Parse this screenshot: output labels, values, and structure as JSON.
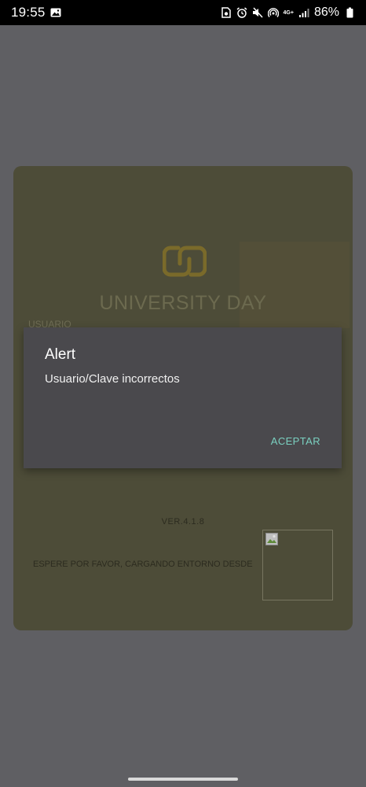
{
  "status_bar": {
    "time": "19:55",
    "network_label": "4G+",
    "battery": "86%",
    "left_icons": [
      "gallery-icon"
    ],
    "right_icons": [
      "sim-icon",
      "alarm-icon",
      "mute-icon",
      "hotspot-icon",
      "signal-icon",
      "battery-icon"
    ]
  },
  "login": {
    "brand": "UNIVERSITY DAY",
    "username_label": "USUARIO",
    "version": "VER.4.1.8",
    "loading_text": "ESPERE POR FAVOR, CARGANDO ENTORNO DESDE",
    "logo_color": "#7a6a2a"
  },
  "alert": {
    "title": "Alert",
    "message": "Usuario/Clave incorrectos",
    "button_label": "ACEPTAR",
    "button_color": "#7ad0c0"
  },
  "colors": {
    "overlay": "#5f5f63",
    "card": "#4d4c38",
    "dialog": "#4a494d"
  }
}
